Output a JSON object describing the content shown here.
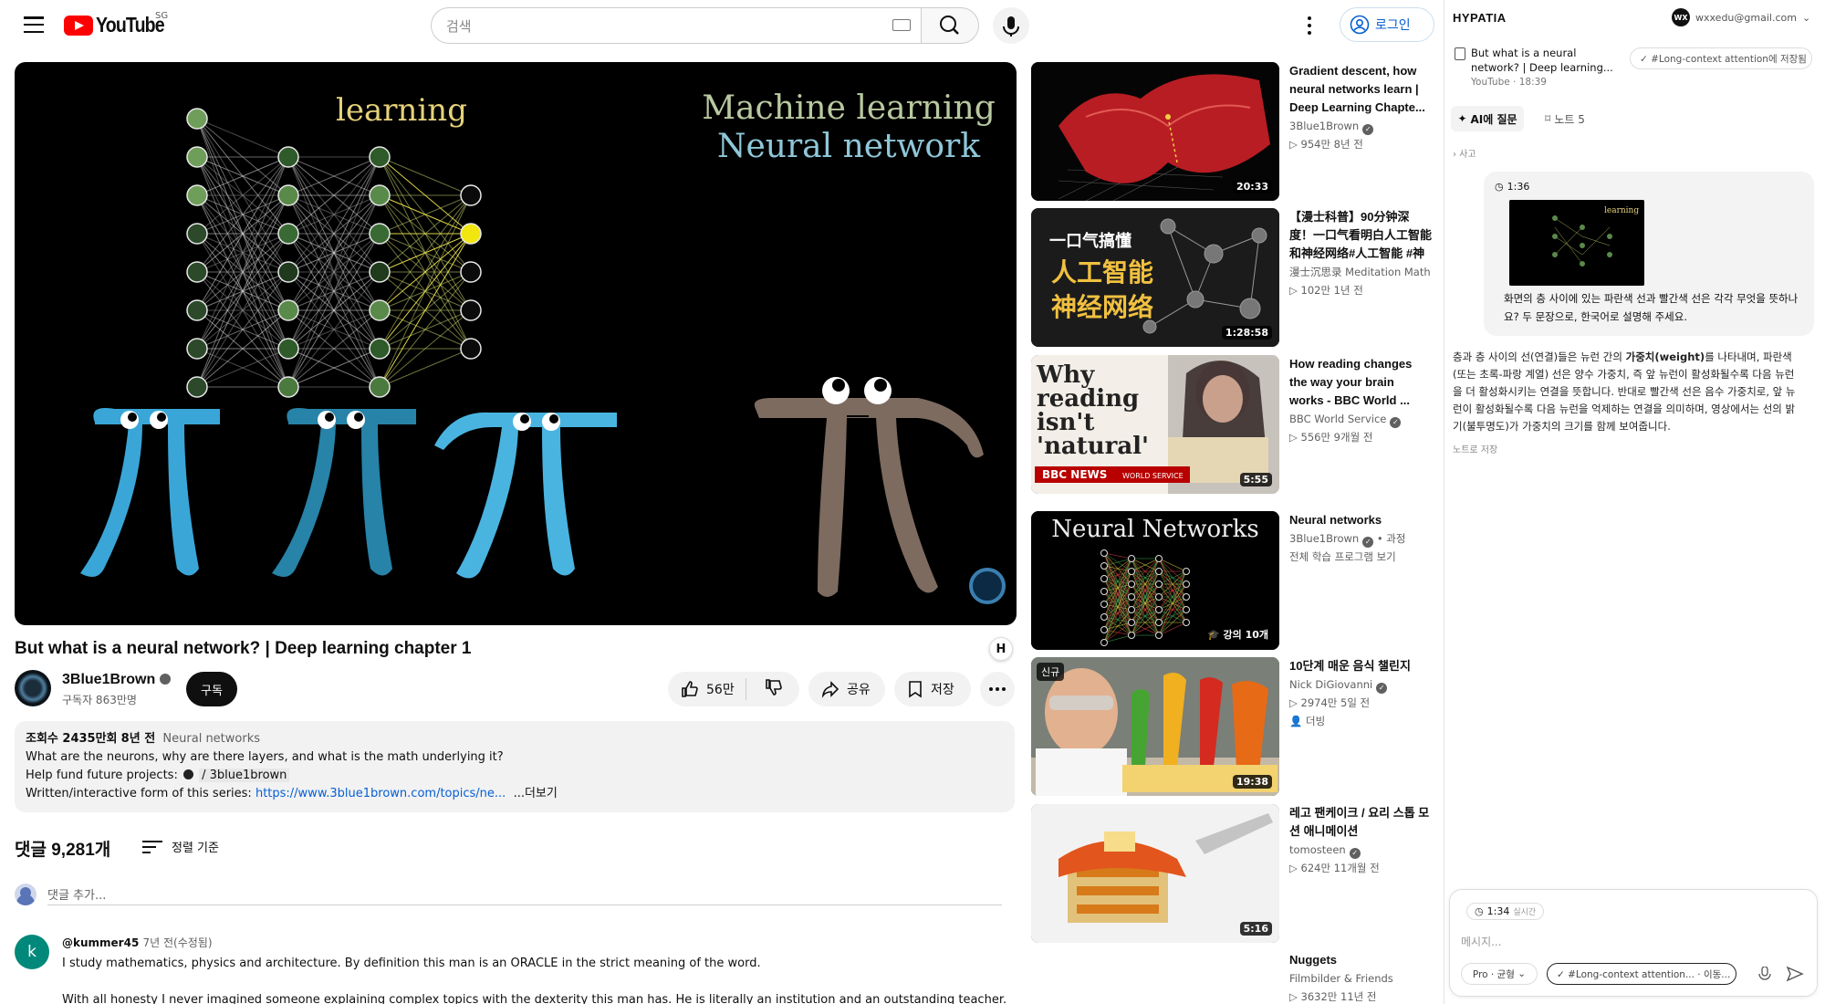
{
  "youtube": {
    "logo_text": "YouTube",
    "region": "SG",
    "search_placeholder": "검색",
    "login_label": "로그인"
  },
  "video": {
    "title": "But what is a neural network? | Deep learning chapter 1",
    "overlay_title_left": "learning",
    "overlay_title_right_1": "Machine learning",
    "overlay_title_right_2": "Neural network",
    "h_badge": "H",
    "channel": "3Blue1Brown",
    "subscribers": "구독자 863만명",
    "subscribe_label": "구독",
    "likes": "56만",
    "share_label": "공유",
    "save_label": "저장",
    "description": {
      "views": "조회수 2435만회",
      "age": "8년 전",
      "tag": "Neural networks",
      "line1": "What are the neurons, why are there layers, and what is the math underlying it?",
      "line2_prefix": "Help fund future projects:",
      "line2_link": "/ 3blue1brown",
      "line3_prefix": "Written/interactive form of this series:",
      "line3_link": "https://www.3blue1brown.com/topics/ne...",
      "more": "...더보기"
    }
  },
  "comments": {
    "count": "댓글 9,281개",
    "sort_label": "정렬 기준",
    "add_placeholder": "댓글 추가...",
    "first": {
      "avatar_letter": "k",
      "user": "@kummer45",
      "age": "7년 전(수정됨)",
      "text1": "I study mathematics, physics and architecture. By definition this man is an ORACLE in the strict meaning of the word.",
      "text2": "With all honesty I never imagined someone explaining complex topics with the dexterity this man has. He is literally an institution and an outstanding teacher."
    }
  },
  "related": [
    {
      "title": "Gradient descent, how neural networks learn | Deep Learning Chapte...",
      "channel": "3Blue1Brown",
      "verified": true,
      "views": "▷ 954만 8년 전",
      "duration": "20:33"
    },
    {
      "title": "【漫士科普】90分钟深度！一口气看明白人工智能和神经网络#人工智能 #神经网...",
      "channel": "漫士沉思录 Meditation Math",
      "verified": false,
      "views": "▷ 102만 1년 전",
      "duration": "1:28:58",
      "thumb_text_1": "一口气搞懂",
      "thumb_text_2": "人工智能",
      "thumb_text_3": "神经网络"
    },
    {
      "title": "How reading changes the way your brain works - BBC World ...",
      "channel": "BBC World Service",
      "verified": true,
      "views": "▷ 556만 9개월 전",
      "duration": "5:55",
      "thumb_text_1": "Why",
      "thumb_text_2": "reading",
      "thumb_text_3": "isn't",
      "thumb_text_4": "'natural'",
      "thumb_text_5": "BBC NEWS",
      "thumb_text_6": "WORLD SERVICE"
    },
    {
      "title": "Neural networks",
      "channel": "3Blue1Brown",
      "verified": true,
      "channel_suffix": "• 과정",
      "views": "전체 학습 프로그램 보기",
      "duration": "강의 10개",
      "thumb_text_1": "Neural Networks"
    },
    {
      "title": "10단계 매운 음식 챌린지",
      "channel": "Nick DiGiovanni",
      "verified": true,
      "views": "▷ 2974만 5일 전",
      "extra": "더빙",
      "duration": "19:38",
      "badge": "신규"
    },
    {
      "title": "레고 팬케이크 / 요리 스톱 모션 애니메이션",
      "channel": "tomosteen",
      "verified": true,
      "views": "▷ 624만 11개월 전",
      "duration": "5:16"
    },
    {
      "title": "Nuggets",
      "channel": "Filmbilder & Friends",
      "verified": false,
      "views": "▷ 3632만 11년 전"
    }
  ],
  "hypatia": {
    "name": "HYPATIA",
    "account_initials": "WX",
    "account_email": "wxxedu@gmail.com",
    "video_title": "But what is a neural network? | Deep learning...",
    "video_source": "YouTube · 18:39",
    "saved_chip": "✓ #Long-context attention에 저장됨",
    "tab_ai": "AI에 질문",
    "tab_notes": "노트 5",
    "thinking": "› 사고",
    "question_time": "1:36",
    "mini_thumb_text": "learning",
    "question": "화면의 층 사이에 있는 파란색 선과 빨간색 선은 각각 무엇을 뜻하나요? 두 문장으로, 한국어로 설명해 주세요.",
    "answer_pre": "층과 층 사이의 선(연결)들은 뉴런 간의 ",
    "answer_bold": "가중치(weight)",
    "answer_post": "를 나타내며, 파란색(또는 초록-파랑 계열) 선은 양수 가중치, 즉 앞 뉴런이 활성화될수록 다음 뉴런을 더 활성화시키는 연결을 뜻합니다. 반대로 빨간색 선은 음수 가중치로, 앞 뉴런이 활성화될수록 다음 뉴런을 억제하는 연결을 의미하며, 영상에서는 선의 밝기(불투명도)가 가중치의 크기를 함께 보여줍니다.",
    "save_note": "노트로 저장",
    "composer_time": "1:34",
    "composer_time_tag": "실시간",
    "composer_placeholder": "메시지...",
    "model_label": "Pro · 균형",
    "context_label": "✓ #Long-context attention... · 이동..."
  },
  "colors": {
    "youtube_red": "#ff0000",
    "link_blue": "#065fd4",
    "pi_blue": "#3aa6d8",
    "pi_brown": "#7d6b60"
  }
}
